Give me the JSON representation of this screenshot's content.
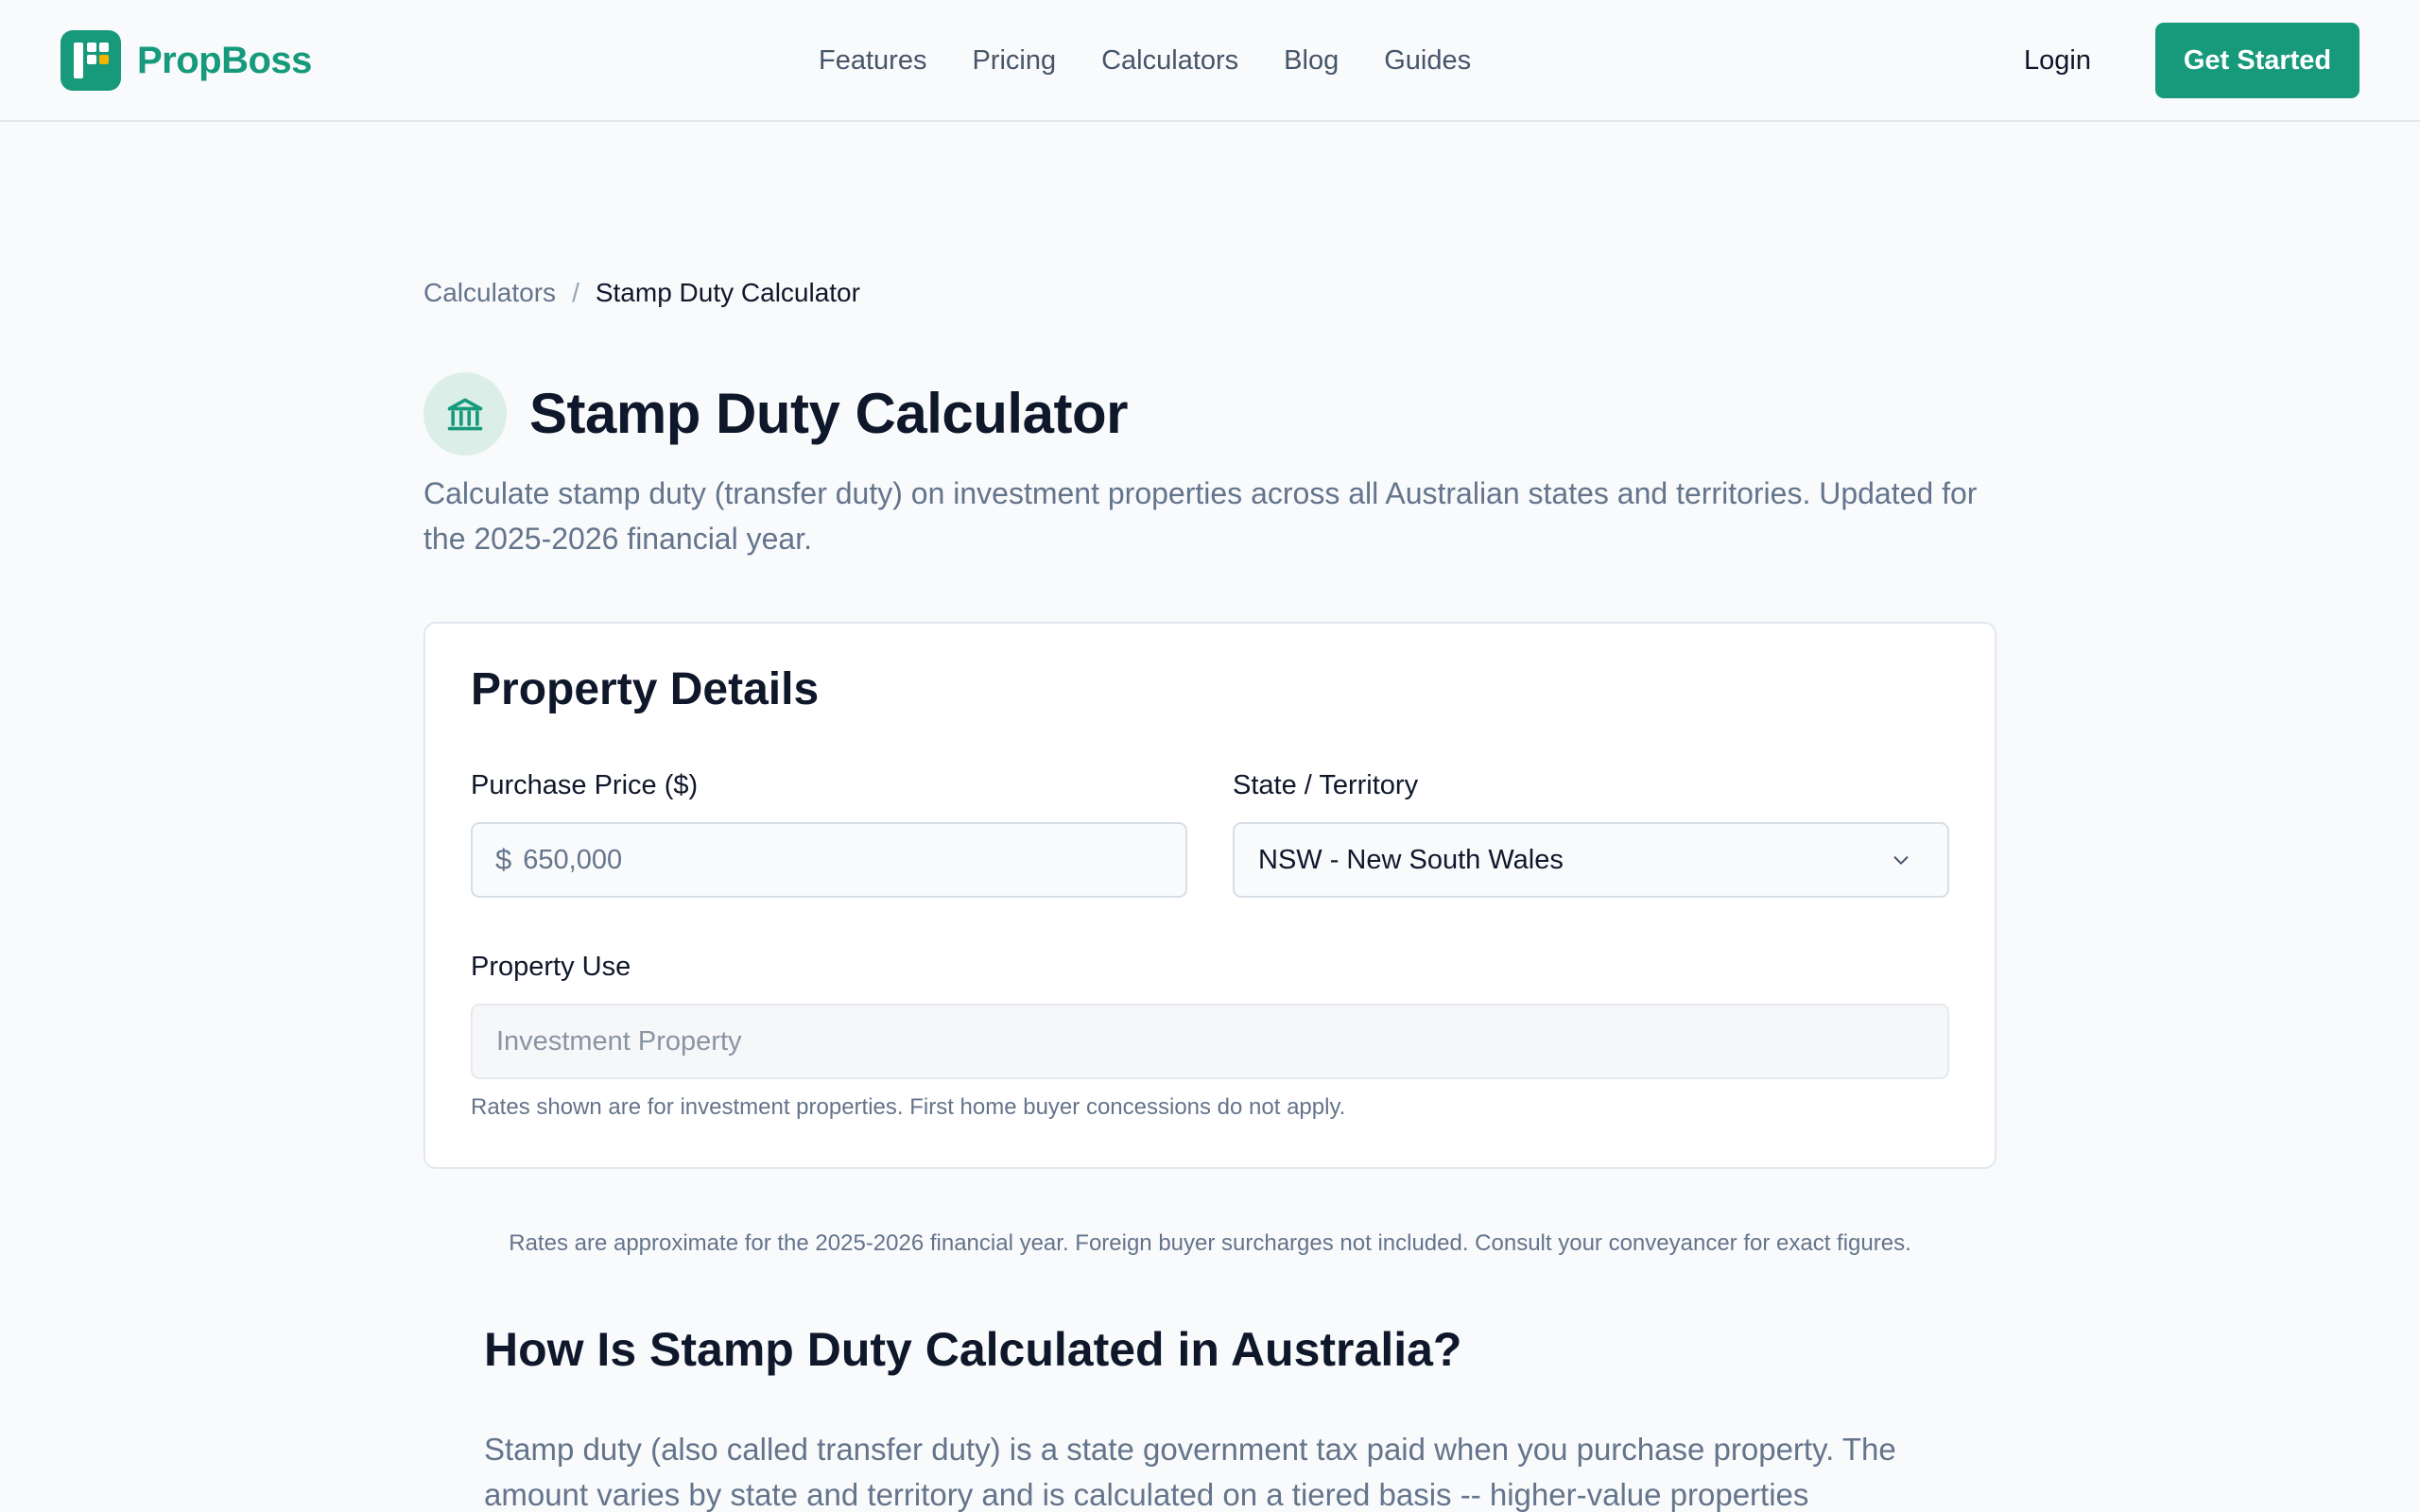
{
  "brand": {
    "name": "PropBoss",
    "accent": "#169a7b",
    "logo_dot_color": "#f5b301"
  },
  "nav": {
    "items": [
      "Features",
      "Pricing",
      "Calculators",
      "Blog",
      "Guides"
    ],
    "login": "Login",
    "cta": "Get Started"
  },
  "breadcrumb": {
    "parent": "Calculators",
    "separator": "/",
    "current": "Stamp Duty Calculator"
  },
  "page": {
    "icon": "bank-building-icon",
    "title": "Stamp Duty Calculator",
    "subtitle": "Calculate stamp duty (transfer duty) on investment properties across all Australian states and territories. Updated for the 2025-2026 financial year."
  },
  "form": {
    "title": "Property Details",
    "price_label": "Purchase Price ($)",
    "price_prefix": "$",
    "price_value": "650,000",
    "state_label": "State / Territory",
    "state_value": "NSW - New South Wales",
    "use_label": "Property Use",
    "use_value": "Investment Property",
    "hint": "Rates shown are for investment properties. First home buyer concessions do not apply."
  },
  "disclaimer": "Rates are approximate for the 2025-2026 financial year. Foreign buyer surcharges not included. Consult your conveyancer for exact figures.",
  "section": {
    "title": "How Is Stamp Duty Calculated in Australia?",
    "body": "Stamp duty (also called transfer duty) is a state government tax paid when you purchase property. The amount varies by state and territory and is calculated on a tiered basis -- higher-value properties"
  }
}
